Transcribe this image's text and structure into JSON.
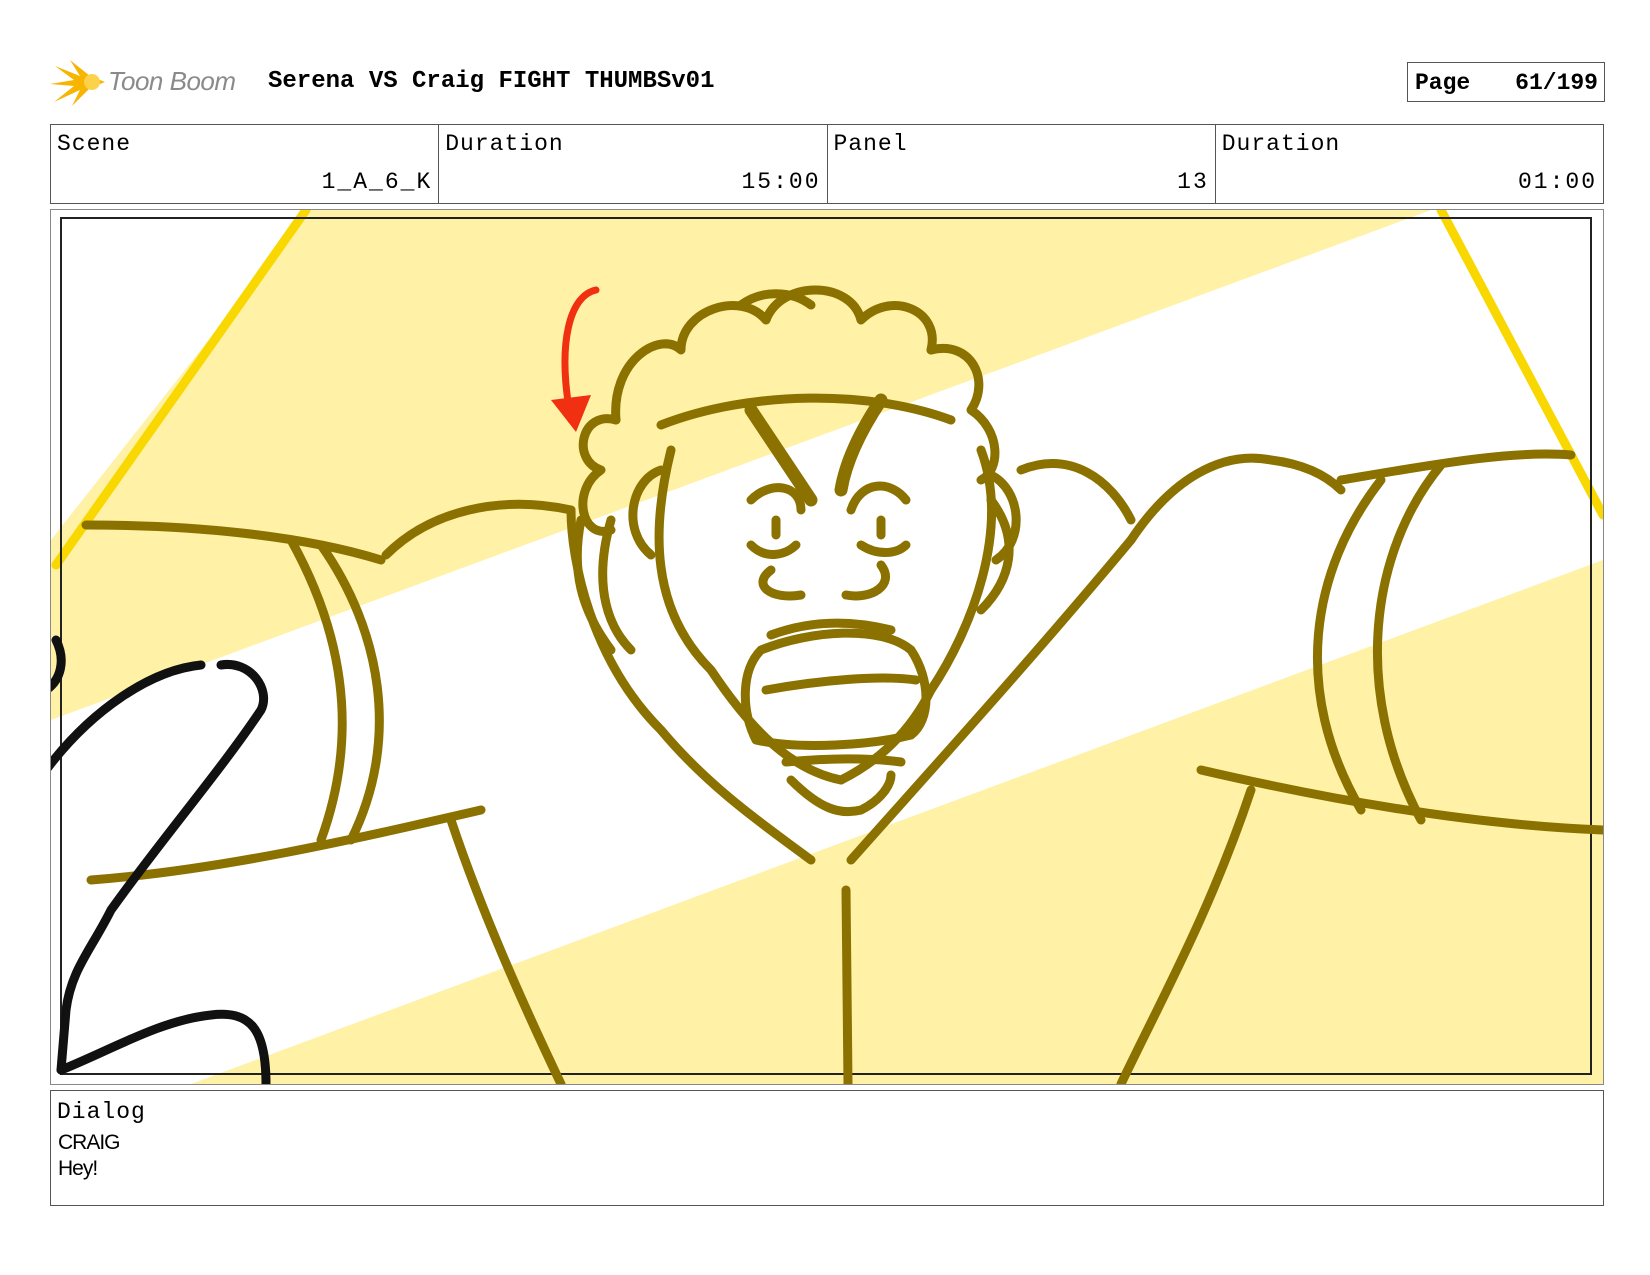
{
  "header": {
    "logo_text": "Toon Boom",
    "title": "Serena VS Craig FIGHT THUMBSv01",
    "page_label": "Page",
    "page_value": "61/199"
  },
  "info": {
    "scene_label": "Scene",
    "scene_value": "1_A_6_K",
    "scene_duration_label": "Duration",
    "scene_duration_value": "15:00",
    "panel_label": "Panel",
    "panel_value": "13",
    "panel_duration_label": "Duration",
    "panel_duration_value": "01:00"
  },
  "dialog": {
    "label": "Dialog",
    "speaker": "CRAIG",
    "line": "Hey!"
  },
  "colors": {
    "sketch_line": "#8a7100",
    "background_yellow": "#fff1a6",
    "accent_yellow": "#f8d800",
    "arrow_red": "#f03010",
    "logo_orange": "#f7b500"
  }
}
